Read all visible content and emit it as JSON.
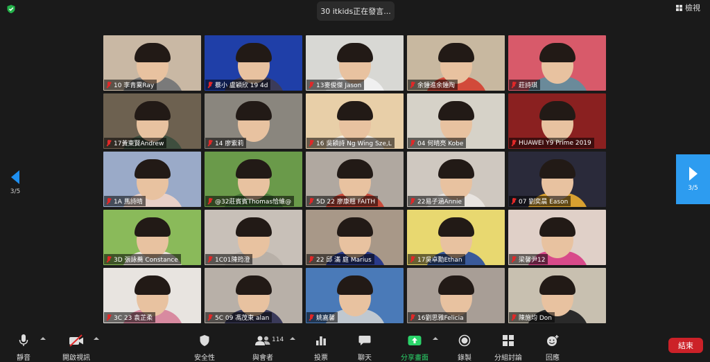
{
  "top": {
    "sharing_banner": "30 itkids正在發言...",
    "view_label": "檢視"
  },
  "nav": {
    "left_page": "3/5",
    "right_page": "3/5"
  },
  "participants": [
    {
      "name": "10 李青霙Ray",
      "bg": "#c9b8a4",
      "shirt": "#7a7a7a"
    },
    {
      "name": "蔡小 盧穎欣 19 4d",
      "bg": "#1f3fa8",
      "shirt": "#3b3b5a"
    },
    {
      "name": "13麥俊傑 Jason",
      "bg": "#d8d8d4",
      "shirt": "#f0f0f0"
    },
    {
      "name": "余鍾進余鍾陶",
      "bg": "#c8b8a0",
      "shirt": "#d24a3a"
    },
    {
      "name": "莊詩琪",
      "bg": "#d85a6a",
      "shirt": "#6a8a9a"
    },
    {
      "name": "17黃東賢Andrew",
      "bg": "#6d6150",
      "shirt": "#3e4e3e"
    },
    {
      "name": "14 廖紫莉",
      "bg": "#8a867e",
      "shirt": "#8a867e"
    },
    {
      "name": "16 吳穎詩 Ng Wing Sze,L",
      "bg": "#e8cfa8",
      "shirt": "#f3ece0"
    },
    {
      "name": "04 何晴亮 Kobe",
      "bg": "#d6d2c8",
      "shirt": "#d6d2c8"
    },
    {
      "name": "HUAWEI Y9 Prime 2019",
      "bg": "#8a2020",
      "shirt": "#8a2020"
    },
    {
      "name": "1A 馬詩晴",
      "bg": "#9aaac8",
      "shirt": "#e8d0c8"
    },
    {
      "name": "@32莊賓賓Thomas恰維@",
      "bg": "#6a9a4a",
      "shirt": "#4a7a3a"
    },
    {
      "name": "5D 22 廖康翹 FAITH",
      "bg": "#b0a8a0",
      "shirt": "#c84a3a"
    },
    {
      "name": "22易子涵Annie",
      "bg": "#cfc8c0",
      "shirt": "#e8e4e0"
    },
    {
      "name": "07 劉奕晨 Eason",
      "bg": "#2a2a3a",
      "shirt": "#d8a030"
    },
    {
      "name": "3D 張詠蕎 Constance",
      "bg": "#8aba5a",
      "shirt": "#e8e0d8"
    },
    {
      "name": "1C01陳筠澄",
      "bg": "#c8c0b8",
      "shirt": "#b8b0a8"
    },
    {
      "name": "22 邱 滿 庭 Marius",
      "bg": "#a89888",
      "shirt": "#2a3a8a"
    },
    {
      "name": "17吳卓勳Ethan",
      "bg": "#e8d870",
      "shirt": "#3a5a9a"
    },
    {
      "name": "梁馨尹12",
      "bg": "#e0d0c8",
      "shirt": "#d84a8a"
    },
    {
      "name": "3C 23 袁芷柔",
      "bg": "#e8e4e0",
      "shirt": "#d88aa0"
    },
    {
      "name": "5C 09 馮茂東 alan",
      "bg": "#b8b0a8",
      "shirt": "#3a3a5a"
    },
    {
      "name": "姚嘉馨",
      "bg": "#4a7ab8",
      "shirt": "#c0c8d0"
    },
    {
      "name": "16劉思雅Felicia",
      "bg": "#a89e96",
      "shirt": "#a89e96"
    },
    {
      "name": "陳施均 Don",
      "bg": "#c8c0b0",
      "shirt": "#2a2a2a"
    }
  ],
  "toolbar": {
    "mute": "靜音",
    "video": "開啟視訊",
    "security": "安全性",
    "participants": "與會者",
    "participants_count": "114",
    "polls": "投票",
    "chat": "聊天",
    "share": "分享畫面",
    "record": "錄製",
    "breakout": "分組討論",
    "reactions": "回應",
    "end": "結束"
  },
  "colors": {
    "accent_blue": "#2d9cf0",
    "share_green": "#2bd46a",
    "end_red": "#cc2128",
    "mute_red": "#e02828"
  }
}
